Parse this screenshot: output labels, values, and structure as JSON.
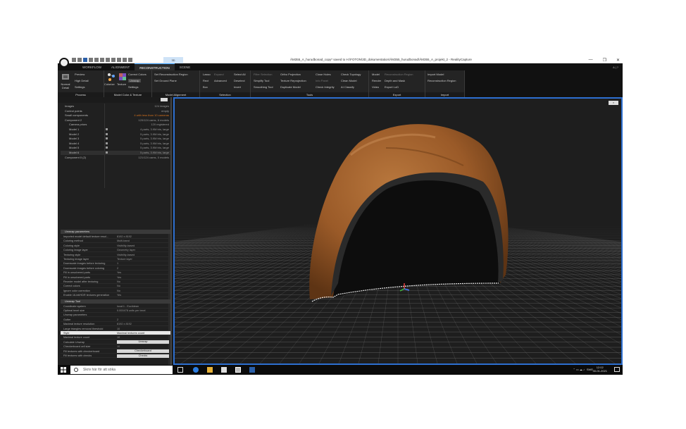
{
  "window": {
    "title": "ÄM355_A_hurudbonad_copy* saved to H:\\FOTON\\3D_dokumentation\\ÄM355_hurudbonad\\ÄM355_A_projekt_2 - RealityCapture",
    "controls": [
      "—",
      "❐",
      "✕"
    ]
  },
  "quick_access": {
    "3d_badge": "3D"
  },
  "tabs": [
    "WORKFLOW",
    "ALIGNMENT",
    "RECONSTRUCTION",
    "SCENE"
  ],
  "tab_active": "RECONSTRUCTION",
  "tab_right": "A | ?",
  "ribbon": {
    "process": {
      "label": "Process",
      "items": [
        "Normal Detail",
        "Preview",
        "High Detail",
        "Settings"
      ]
    },
    "model_color": {
      "label": "Model Color & Texture",
      "colorize": "Colorize",
      "texture": "Texture",
      "items": [
        "Correct Colors",
        "Unwrap",
        "Settings"
      ]
    },
    "model_alignment": {
      "label": "Model Alignment",
      "items": [
        "Set Reconstruction Region",
        "Set Ground Plane"
      ]
    },
    "selection": {
      "label": "Selection",
      "items": [
        "Lasso",
        "Rect",
        "Box",
        "Expand",
        "Advanced",
        "Select All",
        "Deselect",
        "Invert"
      ]
    },
    "tools": {
      "label": "Tools",
      "items": [
        "Filter Selection",
        "Simplify Tool",
        "Smoothing Tool",
        "Ortho Projection",
        "Texture Reprojection",
        "Duplicate Model",
        "Close Holes",
        "Info Panel",
        "Check Integrity",
        "Check Topology",
        "Clean Model",
        "AI Classify"
      ]
    },
    "export": {
      "label": "Export",
      "items": [
        "Model",
        "Render",
        "Video",
        "Reconstruction Region",
        "Depth and Mask",
        "Export LoD"
      ]
    },
    "import": {
      "label": "Import",
      "items": [
        "Import Model",
        "Reconstruction Region"
      ]
    }
  },
  "tree": {
    "rows": [
      {
        "label": "Images",
        "value": "124 images"
      },
      {
        "label": "Control points",
        "value": "empty"
      },
      {
        "label": "Small components",
        "value": "4 with less than 10 cameras",
        "highlight": true
      },
      {
        "label": "Component 2",
        "value": "120/124 cams, 6 models"
      },
      {
        "label": "Camera priors",
        "value": "120 registered"
      },
      {
        "label": "Model 1",
        "value": "4 parts, 3.9M tris, large"
      },
      {
        "label": "Model 2",
        "value": "5 parts, 3.9M tris, large"
      },
      {
        "label": "Model 3",
        "value": "5 parts, 3.9M tris, large"
      },
      {
        "label": "Model 4",
        "value": "5 parts, 3.9M tris, large"
      },
      {
        "label": "Model 5",
        "value": "5 parts, 3.9M tris, large"
      },
      {
        "label": "Model 6",
        "value": "5 parts, 3.9M tris, large"
      },
      {
        "label": "Component 0 (2)",
        "value": "121/124 cams, 0 models"
      }
    ]
  },
  "params": {
    "section1": "Unwrap parameters",
    "rows1": [
      {
        "k": "Imported model default texture resol...",
        "v": "8192 x 8192"
      },
      {
        "k": "Coloring method",
        "v": "Multi-band"
      },
      {
        "k": "Coloring style",
        "v": "Visibility-based"
      },
      {
        "k": "Coloring image layer",
        "v": "Geometry layer"
      },
      {
        "k": "Texturing style",
        "v": "Visibility-based"
      },
      {
        "k": "Texturing image layer",
        "v": "Texture layer"
      },
      {
        "k": "Downscale images before texturing",
        "v": "1"
      },
      {
        "k": "Downscale images before coloring",
        "v": "2"
      },
      {
        "k": "Fill in unsolvered parts",
        "v": "Yes"
      },
      {
        "k": "Fill in unsolvered parts",
        "v": "Yes"
      },
      {
        "k": "Reorder model after texturing",
        "v": "No"
      },
      {
        "k": "Correct colors",
        "v": "No"
      },
      {
        "k": "Ignore color correction",
        "v": "No"
      },
      {
        "k": "Enable 16-bit/HDR textures generation",
        "v": "Yes"
      }
    ],
    "section2": "Unwrap Tool",
    "rows2": [
      {
        "k": "Coordinate system",
        "v": "local:1 - Euclidean"
      },
      {
        "k": "Optimal texel size",
        "v": "0.000478 units per texel"
      },
      {
        "k": "Unwrap parameters",
        "v": ""
      },
      {
        "k": "Gutter",
        "v": "2"
      },
      {
        "k": "Maximal texture resolution",
        "v": "8192 x 8192"
      },
      {
        "k": "Large triangles removal threshold",
        "v": "10"
      },
      {
        "k": "Style",
        "v": "Maximal textures count",
        "hl": true
      },
      {
        "k": "Maximal texture count",
        "v": "10"
      },
      {
        "k": "Calculate Unwrap",
        "btn": "Unwrap"
      },
      {
        "k": "Checkerboard cell size",
        "v": "10"
      },
      {
        "k": "Fill textures with checkerboard",
        "btn": "Checkerboard"
      },
      {
        "k": "Fill textures with checks",
        "btn": "Checks"
      }
    ]
  },
  "viewport": {
    "button": "≡"
  },
  "taskbar": {
    "search_placeholder": "Skriv här för att söka",
    "tray": "SWE",
    "time": "12:02",
    "date": "30-01-2021"
  }
}
